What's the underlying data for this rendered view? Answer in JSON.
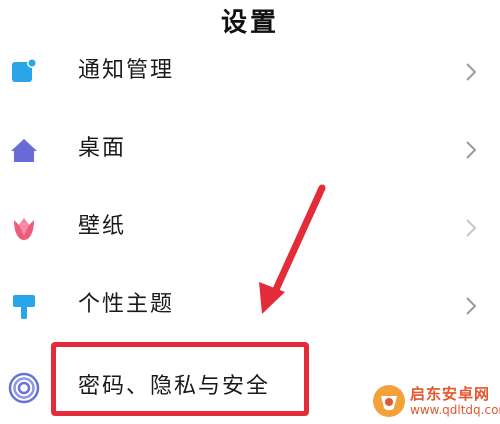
{
  "header": {
    "title": "设置"
  },
  "settings": {
    "items": [
      {
        "label": "通知管理",
        "icon": "notification-icon",
        "color": "#2aa5ea"
      },
      {
        "label": "桌面",
        "icon": "home-icon",
        "color": "#6b6bd8"
      },
      {
        "label": "壁纸",
        "icon": "tulip-icon",
        "color": "#ef5b7d"
      },
      {
        "label": "个性主题",
        "icon": "paint-brush-icon",
        "color": "#2aa5ea"
      },
      {
        "label": "密码、隐私与安全",
        "icon": "fingerprint-icon",
        "color": "#6a72d8"
      }
    ]
  },
  "annotation": {
    "color": "#e32b3a"
  },
  "watermark": {
    "name": "启东安卓网",
    "url": "www.qdltdq.com",
    "color": "#e2572b"
  }
}
